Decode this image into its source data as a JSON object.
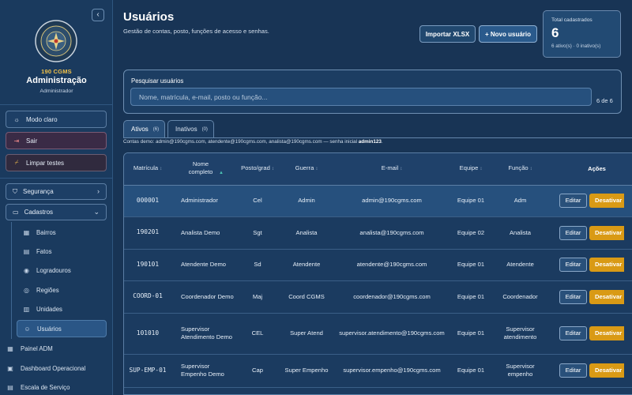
{
  "sidebar": {
    "collapse_icon": "chevron-left-icon",
    "org_code": "190 CGMS",
    "title": "Administração",
    "role": "Administrador",
    "actions": [
      {
        "label": "Modo claro",
        "icon": "sun-icon"
      },
      {
        "label": "Sair",
        "icon": "logout-icon"
      },
      {
        "label": "Limpar testes",
        "icon": "broom-icon"
      }
    ],
    "groups": [
      {
        "label": "Segurança",
        "icon": "shield-icon"
      },
      {
        "label": "Cadastros",
        "icon": "folder-icon"
      }
    ],
    "sub_items": [
      {
        "label": "Bairros",
        "icon": "building-icon"
      },
      {
        "label": "Fatos",
        "icon": "document-icon"
      },
      {
        "label": "Logradouros",
        "icon": "map-pin-icon"
      },
      {
        "label": "Regiões",
        "icon": "globe-icon"
      },
      {
        "label": "Unidades",
        "icon": "office-icon"
      },
      {
        "label": "Usuários",
        "icon": "users-icon"
      }
    ],
    "nav": [
      {
        "label": "Painel ADM",
        "icon": "grid-icon"
      },
      {
        "label": "Dashboard Operacional",
        "icon": "dashboard-icon"
      },
      {
        "label": "Escala de Serviço",
        "icon": "calendar-icon"
      }
    ]
  },
  "header": {
    "title": "Usuários",
    "subtitle": "Gestão de contas, posto, funções de acesso e senhas.",
    "import_label": "Importar XLSX",
    "new_label": "+ Novo usuário"
  },
  "stats": {
    "label": "Total cadastrados",
    "value": "6",
    "foot": "6 ativo(s) · 0 inativo(s)"
  },
  "search": {
    "label": "Pesquisar usuários",
    "placeholder": "Nome, matrícula, e-mail, posto ou função...",
    "count": "6 de 6"
  },
  "tabs": [
    {
      "label": "Ativos",
      "count": "(6)"
    },
    {
      "label": "Inativos",
      "count": "(0)"
    }
  ],
  "demo_note": {
    "text": "Contas demo: admin@190cgms.com, atendente@190cgms.com, analista@190cgms.com — senha inicial",
    "password": "admin123",
    "end": "."
  },
  "table": {
    "headers": {
      "matricula": "Matrícula",
      "nome": "Nome completo",
      "posto": "Posto/grad",
      "guerra": "Guerra",
      "email": "E-mail",
      "equipe": "Equipe",
      "funcao": "Função",
      "acoes": "Ações"
    },
    "edit_label": "Editar",
    "deactivate_label": "Desativar",
    "rows": [
      {
        "matricula": "000001",
        "nome": "Administrador",
        "posto": "Cel",
        "guerra": "Admin",
        "email": "admin@190cgms.com",
        "equipe": "Equipe 01",
        "funcao": "Adm"
      },
      {
        "matricula": "190201",
        "nome": "Analista Demo",
        "posto": "Sgt",
        "guerra": "Analista",
        "email": "analista@190cgms.com",
        "equipe": "Equipe 02",
        "funcao": "Analista"
      },
      {
        "matricula": "190101",
        "nome": "Atendente Demo",
        "posto": "Sd",
        "guerra": "Atendente",
        "email": "atendente@190cgms.com",
        "equipe": "Equipe 01",
        "funcao": "Atendente"
      },
      {
        "matricula": "COORD-01",
        "nome": "Coordenador Demo",
        "posto": "Maj",
        "guerra": "Coord CGMS",
        "email": "coordenador@190cgms.com",
        "equipe": "Equipe 01",
        "funcao": "Coordenador"
      },
      {
        "matricula": "101010",
        "nome": "Supervisor Atendimento Demo",
        "posto": "CEL",
        "guerra": "Super Atend",
        "email": "supervisor.atendimento@190cgms.com",
        "equipe": "Equipe 01",
        "funcao": "Supervisor atendimento"
      },
      {
        "matricula": "SUP-EMP-01",
        "nome": "Supervisor Empenho Demo",
        "posto": "Cap",
        "guerra": "Super Empenho",
        "email": "supervisor.empenho@190cgms.com",
        "equipe": "Equipe 01",
        "funcao": "Supervisor empenho"
      }
    ]
  },
  "colors": {
    "background": "#183455",
    "sidebar": "#1a3a5e",
    "accent_gold": "#f0c14a",
    "deactivate": "#d99a15",
    "sort_active": "#4cc2b4"
  }
}
